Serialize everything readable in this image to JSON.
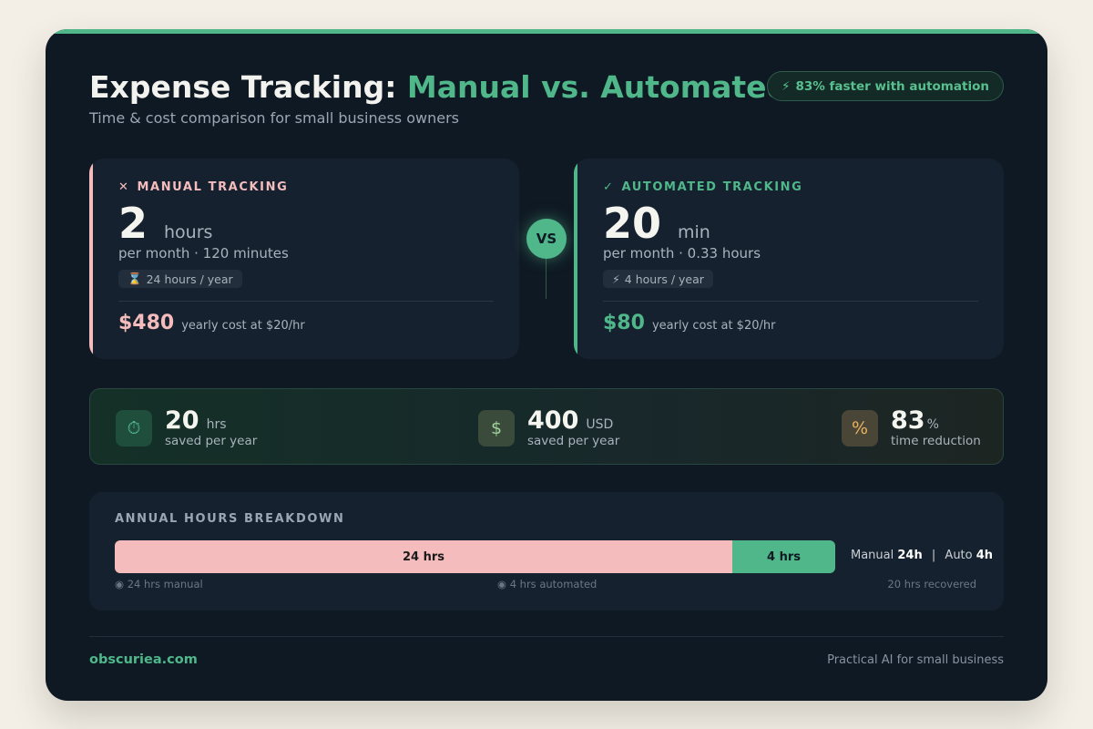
{
  "header": {
    "title_main": "Expense Tracking:",
    "title_accent": "Manual vs. Automated",
    "subtitle": "Time & cost comparison for small business owners",
    "badge_icon": "⚡",
    "badge_text": "83% faster with automation"
  },
  "manual": {
    "icon": "✕",
    "label": "MANUAL TRACKING",
    "value": "2",
    "unit": "hours",
    "per_month": "per month · 120 minutes",
    "pill_icon": "⌛",
    "pill_text": "24 hours / year",
    "cost": "$480",
    "cost_note": "yearly cost at $20/hr"
  },
  "vs_label": "VS",
  "auto": {
    "icon": "✓",
    "label": "AUTOMATED TRACKING",
    "value": "20",
    "unit": "min",
    "per_month": "per month · 0.33 hours",
    "pill_icon": "⚡",
    "pill_text": "4 hours / year",
    "cost": "$80",
    "cost_note": "yearly cost at $20/hr"
  },
  "stats": [
    {
      "icon": "⏱",
      "icon_name": "stopwatch-icon",
      "value": "20",
      "unit": "hrs",
      "desc": "saved per year"
    },
    {
      "icon": "$",
      "icon_name": "dollar-icon",
      "value": "400",
      "unit": "USD",
      "desc": "saved per year"
    },
    {
      "icon": "%",
      "icon_name": "percent-icon",
      "value": "83",
      "unit": "%",
      "desc": "time reduction"
    }
  ],
  "breakdown": {
    "title": "ANNUAL HOURS BREAKDOWN",
    "manual_label": "24 hrs",
    "auto_label": "4 hrs",
    "manual_hours": 24,
    "auto_hours": 4,
    "summary_manual_prefix": "Manual",
    "summary_manual_value": "24h",
    "summary_sep": "|",
    "summary_auto_prefix": "Auto",
    "summary_auto_value": "4h",
    "legend_manual": "◉ 24 hrs manual",
    "legend_auto": "◉ 4 hrs automated",
    "legend_recovered": "20 hrs recovered"
  },
  "footer": {
    "brand": "obscuriea.com",
    "tagline": "Practical AI for small business"
  },
  "colors": {
    "accent": "#4fb789",
    "manual": "#f4bcbc",
    "background": "#0f1923"
  }
}
